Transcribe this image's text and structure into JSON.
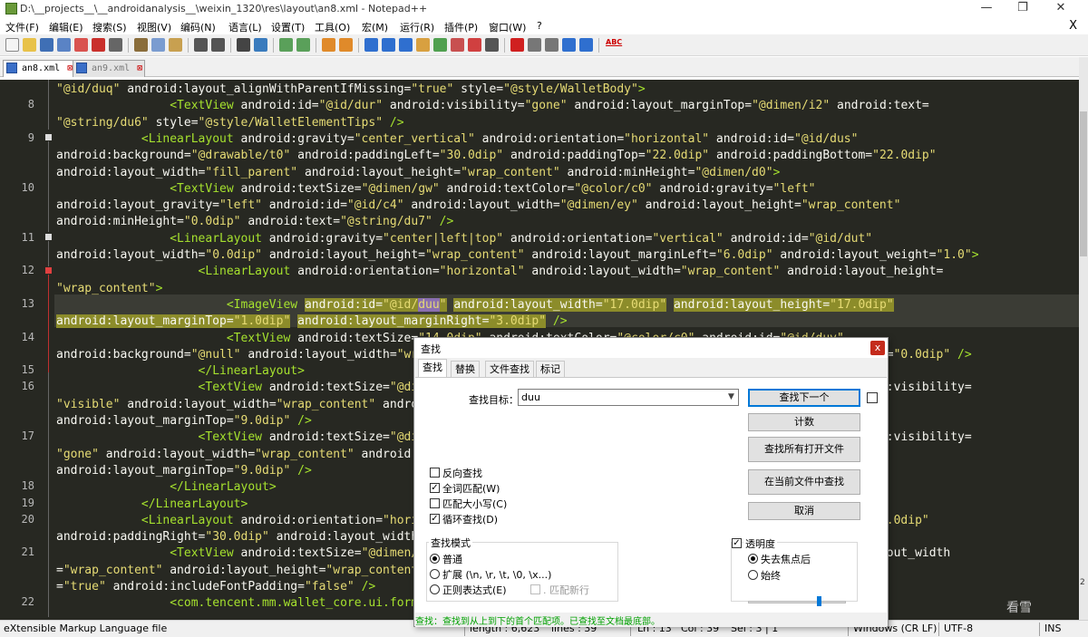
{
  "window": {
    "title": "D:\\__projects__\\__androidanalysis__\\weixin_1320\\res\\layout\\an8.xml - Notepad++",
    "minimize": "—",
    "restore": "❐",
    "close": "✕"
  },
  "menu": {
    "items": [
      "文件(F)",
      "编辑(E)",
      "搜索(S)",
      "视图(V)",
      "编码(N)",
      "语言(L)",
      "设置(T)",
      "工具(O)",
      "宏(M)",
      "运行(R)",
      "插件(P)",
      "窗口(W)",
      "?"
    ],
    "close_x": "X"
  },
  "toolbar": {
    "spell_label": "ABC"
  },
  "tabs": [
    {
      "label": "an8.xml",
      "close": "⊠"
    },
    {
      "label": "an9.xml",
      "close": "⊠"
    }
  ],
  "editor": {
    "line_numbers": [
      {
        "n": "8",
        "row": 1
      },
      {
        "n": "9",
        "row": 3
      },
      {
        "n": "10",
        "row": 6
      },
      {
        "n": "11",
        "row": 9
      },
      {
        "n": "12",
        "row": 11
      },
      {
        "n": "13",
        "row": 13
      },
      {
        "n": "14",
        "row": 15
      },
      {
        "n": "15",
        "row": 17
      },
      {
        "n": "16",
        "row": 18
      },
      {
        "n": "17",
        "row": 21
      },
      {
        "n": "18",
        "row": 24
      },
      {
        "n": "19",
        "row": 25
      },
      {
        "n": "20",
        "row": 26
      },
      {
        "n": "21",
        "row": 28
      },
      {
        "n": "22",
        "row": 31
      }
    ],
    "lines": [
      "\"@id/duq\" android:layout_alignWithParentIfMissing=\"true\" style=\"@style/WalletBody\">",
      "                <TextView android:id=\"@id/dur\" android:visibility=\"gone\" android:layout_marginTop=\"@dimen/i2\" android:text=",
      "\"@string/du6\" style=\"@style/WalletElementTips\" />",
      "            <LinearLayout android:gravity=\"center_vertical\" android:orientation=\"horizontal\" android:id=\"@id/dus\"",
      "android:background=\"@drawable/t0\" android:paddingLeft=\"30.0dip\" android:paddingTop=\"22.0dip\" android:paddingBottom=\"22.0dip\"",
      "android:layout_width=\"fill_parent\" android:layout_height=\"wrap_content\" android:minHeight=\"@dimen/d0\">",
      "                <TextView android:textSize=\"@dimen/gw\" android:textColor=\"@color/c0\" android:gravity=\"left\"",
      "android:layout_gravity=\"left\" android:id=\"@id/c4\" android:layout_width=\"@dimen/ey\" android:layout_height=\"wrap_content\"",
      "android:minHeight=\"0.0dip\" android:text=\"@string/du7\" />",
      "                <LinearLayout android:gravity=\"center|left|top\" android:orientation=\"vertical\" android:id=\"@id/dut\"",
      "android:layout_width=\"0.0dip\" android:layout_height=\"wrap_content\" android:layout_marginLeft=\"6.0dip\" android:layout_weight=\"1.0\">",
      "                    <LinearLayout android:orientation=\"horizontal\" android:layout_width=\"wrap_content\" android:layout_height=",
      "\"wrap_content\">",
      "                        <ImageView android:id=\"@id/duu\" android:layout_width=\"17.0dip\" android:layout_height=\"17.0dip\"",
      "android:layout_marginTop=\"1.0dip\" android:layout_marginRight=\"3.0dip\" />",
      "                        <TextView android:textSize=\"14.0dip\" android:textColor=\"@color/c0\" android:id=\"@id/duv\"",
      "android:background=\"@null\" android:layout_width=\"wrap_content\" android:layout_height=\"wrap_content\" android:minHeight=\"0.0dip\" />",
      "                    </LinearLayout>",
      "                    <TextView android:textSize=\"@dimen/gv\" android:textColor=\"@color/c0\" android:id=\"@id/duw\" android:visibility=",
      "\"visible\" android:layout_width=\"wrap_content\" android:layout_height=\"wrap_content\" android:minHeight=\"0.0dip\"",
      "android:layout_marginTop=\"9.0dip\" />",
      "                    <TextView android:textSize=\"@dimen/gv\" android:textColor=\"@color/c0\" android:id=\"@id/dux\" android:visibility=",
      "\"gone\" android:layout_width=\"wrap_content\" android:layout_height=\"wrap_content\" android:minHeight=\"0.0dip\"",
      "android:layout_marginTop=\"9.0dip\" />",
      "                </LinearLayout>",
      "            </LinearLayout>",
      "            <LinearLayout android:orientation=\"horizontal\" android:layout_width=\"fill_parent\" android:paddingLeft=\"30.0dip\"",
      "android:paddingRight=\"30.0dip\" android:layout_width=\"fill_parent\" android:layout_height=\"wrap_content\"",
      "                <TextView android:textSize=\"@dimen/gw\" android:textColor=\"@color/c0\" android:id=\"@id/duy\" android:layout_width",
      "=\"wrap_content\" android:layout_height=\"wrap_content\" android:text=\"@string/dub\" android:singleLine",
      "=\"true\" android:includeFontPadding=\"false\" />",
      "                <com.tencent.mm.wallet_core.ui.formview.WalletTextView android:layout_marginLeft=\"0.0dip\""
    ]
  },
  "find_dialog": {
    "title": "查找",
    "close": "x",
    "tabs": [
      "查找",
      "替换",
      "文件查找",
      "标记"
    ],
    "find_label": "查找目标：",
    "find_value": "duu",
    "buttons": {
      "find_next": "查找下一个",
      "count": "计数",
      "find_all_open": "查找所有打开文件",
      "find_all_current": "在当前文件中查找",
      "cancel": "取消"
    },
    "options": [
      {
        "label": "反向查找",
        "checked": false
      },
      {
        "label": "全词匹配(W)",
        "checked": true
      },
      {
        "label": "匹配大小写(C)",
        "checked": false
      },
      {
        "label": "循环查找(D)",
        "checked": true
      }
    ],
    "search_mode": {
      "title": "查找模式",
      "normal": "普通",
      "extended": "扩展 (\\n, \\r, \\t, \\0, \\x...)",
      "regex": "正则表达式(E)",
      "dot_newline": ". 匹配新行"
    },
    "transparency": {
      "title": "透明度",
      "on_lose_focus": "失去焦点后",
      "always": "始终",
      "level": 0.72
    },
    "status": "查找：查找到从上到下的首个匹配项。已查找至文档最底部。"
  },
  "status_bar": {
    "language": "eXtensible Markup Language file",
    "length": "length : 6,623",
    "lines": "lines : 39",
    "ln": "Ln : 13",
    "col": "Col : 39",
    "sel": "Sel : 3 | 1",
    "eol": "Windows (CR LF)",
    "encoding": "UTF-8",
    "mode": "INS"
  },
  "watermark": "看雪",
  "edge_digit": "2"
}
